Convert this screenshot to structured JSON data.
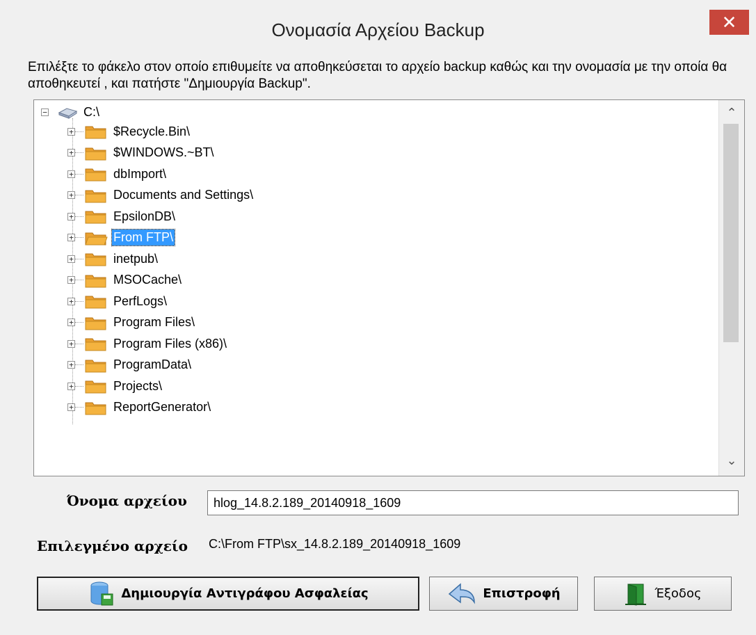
{
  "window": {
    "title": "Ονομασία Αρχείου Backup",
    "close_glyph": "✕"
  },
  "instructions": "Επιλέξτε το φάκελο στον οποίο επιθυμείτε να αποθηκεύσεται το αρχείο backup καθώς  και την ονομασία με την οποία  θα αποθηκευτεί , και πατήστε \"Δημιουργία Backup\".",
  "tree": {
    "root": {
      "label": "C:\\",
      "expander": "−",
      "icon": "drive-icon"
    },
    "items": [
      {
        "label": "$Recycle.Bin\\",
        "expander": "+",
        "selected": false
      },
      {
        "label": "$WINDOWS.~BT\\",
        "expander": "+",
        "selected": false
      },
      {
        "label": "dbImport\\",
        "expander": "+",
        "selected": false
      },
      {
        "label": "Documents and Settings\\",
        "expander": "+",
        "selected": false
      },
      {
        "label": "EpsilonDB\\",
        "expander": "+",
        "selected": false
      },
      {
        "label": "From FTP\\",
        "expander": "+",
        "selected": true
      },
      {
        "label": "inetpub\\",
        "expander": "+",
        "selected": false
      },
      {
        "label": "MSOCache\\",
        "expander": "+",
        "selected": false
      },
      {
        "label": "PerfLogs\\",
        "expander": "+",
        "selected": false
      },
      {
        "label": "Program Files\\",
        "expander": "+",
        "selected": false
      },
      {
        "label": "Program Files (x86)\\",
        "expander": "+",
        "selected": false
      },
      {
        "label": "ProgramData\\",
        "expander": "+",
        "selected": false
      },
      {
        "label": "Projects\\",
        "expander": "+",
        "selected": false
      },
      {
        "label": "ReportGenerator\\",
        "expander": "+",
        "selected": false
      }
    ],
    "scroll_up": "⌃",
    "scroll_down": "⌄"
  },
  "filename": {
    "label": "Όνομα αρχείου",
    "value": "hlog_14.8.2.189_20140918_1609"
  },
  "selected_file": {
    "label": "Επιλεγμένο αρχείο",
    "value": "C:\\From FTP\\sx_14.8.2.189_20140918_1609"
  },
  "buttons": {
    "create_backup": "Δημιουργία Αντιγράφου Ασφαλείας",
    "back": "Επιστροφή",
    "exit": "Έξοδος"
  },
  "colors": {
    "selection": "#3399ff",
    "folder": "#f4b33f",
    "close": "#c7463b"
  }
}
